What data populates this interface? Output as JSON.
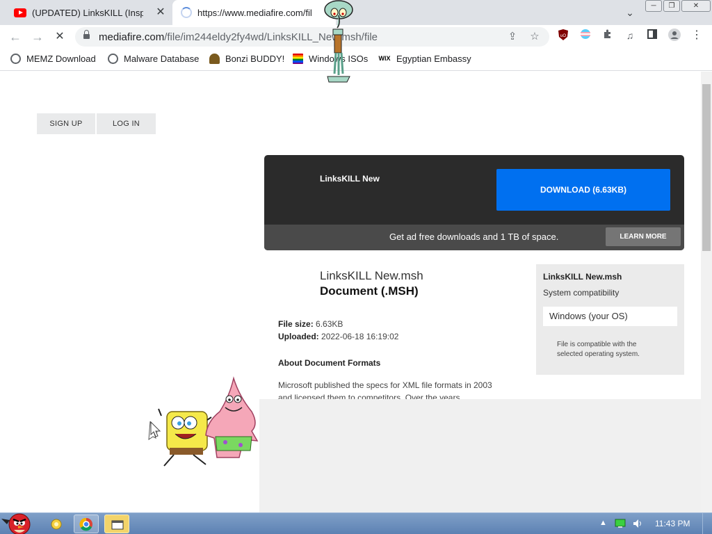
{
  "tabs": [
    {
      "title": "(UPDATED) LinksKILL (Inspired",
      "favicon": "youtube-icon",
      "active": false
    },
    {
      "title": "https://www.mediafire.com/fil",
      "favicon": "loading-spinner-icon",
      "active": true
    }
  ],
  "omnibox": {
    "url_host": "mediafire.com",
    "url_path": "/file/im244eldy2fy4wd/LinksKILL_New.msh/file"
  },
  "bookmarks": [
    {
      "label": "MEMZ Download",
      "icon": "globe-icon"
    },
    {
      "label": "Malware Database",
      "icon": "globe-icon"
    },
    {
      "label": "Bonzi BUDDY!",
      "icon": "bonzi-icon"
    },
    {
      "label": "Windows ISOs",
      "icon": "rainbow-flag-icon"
    },
    {
      "label": "Egyptian Embassy",
      "icon": "wix-icon",
      "icon_text": "WIX"
    }
  ],
  "page": {
    "sign_up": "SIGN UP",
    "log_in": "LOG IN",
    "download_panel": {
      "file_name": "LinksKILL New",
      "download_button": "DOWNLOAD (6.63KB)",
      "promo_text": "Get ad free downloads and 1 TB of space.",
      "learn_more": "LEARN MORE"
    },
    "file_info": {
      "title": "LinksKILL New.msh",
      "type": "Document (.MSH)",
      "size_label": "File size:",
      "size_value": "6.63KB",
      "uploaded_label": "Uploaded:",
      "uploaded_value": "2022-06-18 16:19:02",
      "about_heading": "About Document Formats",
      "about_text": "Microsoft published the specs for XML file formats in 2003 and licensed them to competitors. Over the years"
    },
    "compatibility": {
      "title": "LinksKILL New.msh",
      "subtitle": "System compatibility",
      "os": "Windows (your OS)",
      "note": "File is compatible with the selected operating system."
    }
  },
  "taskbar": {
    "clock": "11:43 PM"
  },
  "colors": {
    "download_blue": "#0070f0",
    "panel_dark": "#2b2b2b",
    "taskbar": "#5d82b3"
  }
}
